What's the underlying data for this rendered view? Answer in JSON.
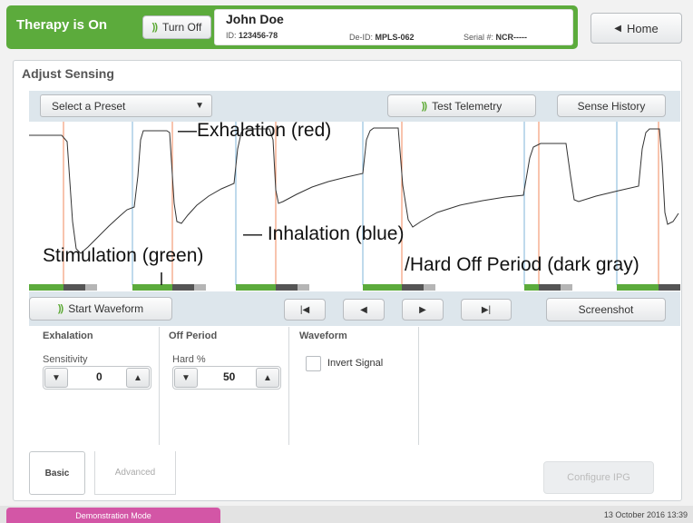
{
  "header": {
    "therapy_status": "Therapy is On",
    "turn_off_label": "Turn Off",
    "patient": {
      "name": "John Doe",
      "id_label": "ID:",
      "id_value": "123456-78",
      "deid_label": "De-ID:",
      "deid_value": "MPLS-062",
      "serial_label": "Serial #:",
      "serial_value": "NCR-----"
    },
    "home_label": "Home",
    "accent_color": "#5cab3c"
  },
  "panel": {
    "title": "Adjust Sensing",
    "preset_select": {
      "selected": "Select a Preset"
    },
    "test_telemetry_label": "Test Telemetry",
    "sense_history_label": "Sense History"
  },
  "waveform": {
    "annotations": {
      "exhalation": "Exhalation (red)",
      "inhalation": "Inhalation (blue)",
      "stimulation": "Stimulation (green)",
      "hard_off": "Hard Off Period (dark gray)"
    },
    "colors": {
      "exhalation": "#f08a5d",
      "inhalation": "#7fb4d8",
      "stimulation": "#5cab3c",
      "hard_off": "#555555",
      "soft_off": "#b5b5b5",
      "signal": "#333333"
    }
  },
  "controls": {
    "start_waveform_label": "Start Waveform",
    "screenshot_label": "Screenshot",
    "nav_icons": [
      "skip-to-start-icon",
      "step-back-icon",
      "play-icon",
      "skip-to-end-icon"
    ]
  },
  "settings": {
    "exhalation": {
      "title": "Exhalation",
      "label": "Sensitivity",
      "value": "0"
    },
    "off_period": {
      "title": "Off Period",
      "label": "Hard %",
      "value": "50"
    },
    "waveform": {
      "title": "Waveform",
      "invert_label": "Invert Signal",
      "invert_checked": false
    }
  },
  "tabs": {
    "basic": "Basic",
    "advanced": "Advanced"
  },
  "configure_label": "Configure IPG",
  "status": {
    "mode": "Demonstration Mode",
    "datetime": "13 October 2016 13:39"
  }
}
